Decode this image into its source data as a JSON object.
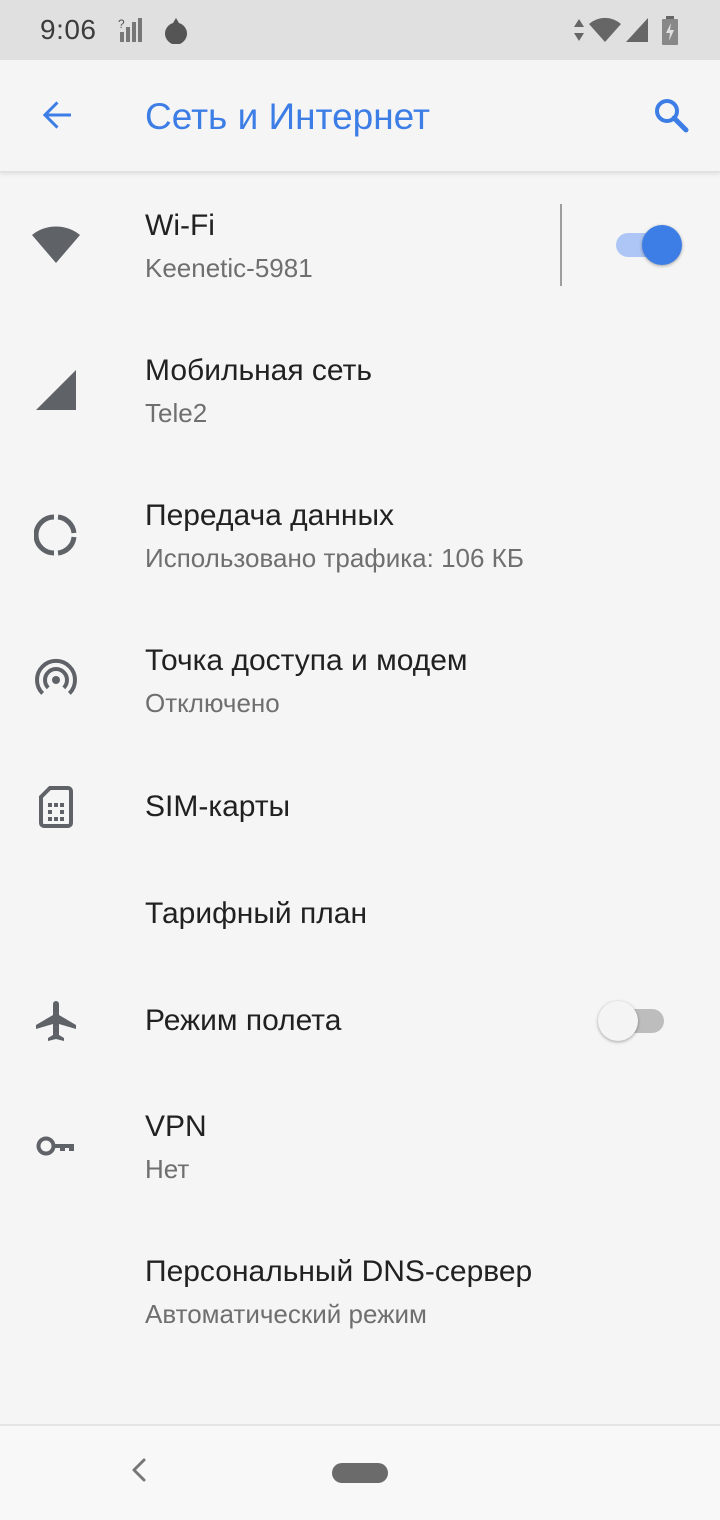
{
  "status_bar": {
    "time": "9:06",
    "icons": [
      "signal-no-data-icon",
      "app-notification-icon",
      "data-arrows-icon",
      "wifi-icon",
      "cell-signal-icon",
      "battery-charging-icon"
    ]
  },
  "header": {
    "title": "Сеть и Интернет",
    "back_icon": "arrow-left-icon",
    "search_icon": "search-icon",
    "accent_color": "#3d7ee6"
  },
  "items": [
    {
      "id": "wifi",
      "title": "Wi-Fi",
      "subtitle": "Keenetic-5981",
      "icon": "wifi-icon",
      "toggle": true
    },
    {
      "id": "mobile",
      "title": "Мобильная сеть",
      "subtitle": "Tele2",
      "icon": "cell-signal-icon"
    },
    {
      "id": "data",
      "title": "Передача данных",
      "subtitle": "Использовано трафика: 106 КБ",
      "icon": "data-usage-icon"
    },
    {
      "id": "hotspot",
      "title": "Точка доступа и модем",
      "subtitle": "Отключено",
      "icon": "hotspot-icon"
    },
    {
      "id": "sim",
      "title": "SIM-карты",
      "icon": "sim-card-icon"
    },
    {
      "id": "tariff",
      "title": "Тарифный план"
    },
    {
      "id": "airplane",
      "title": "Режим полета",
      "icon": "airplane-icon",
      "toggle": false
    },
    {
      "id": "vpn",
      "title": "VPN",
      "subtitle": "Нет",
      "icon": "vpn-key-icon"
    },
    {
      "id": "dns",
      "title": "Персональный DNS-сервер",
      "subtitle": "Автоматический режим"
    }
  ],
  "nav_bar": {
    "back_icon": "nav-back-icon",
    "home_icon": "nav-home-pill-icon"
  }
}
